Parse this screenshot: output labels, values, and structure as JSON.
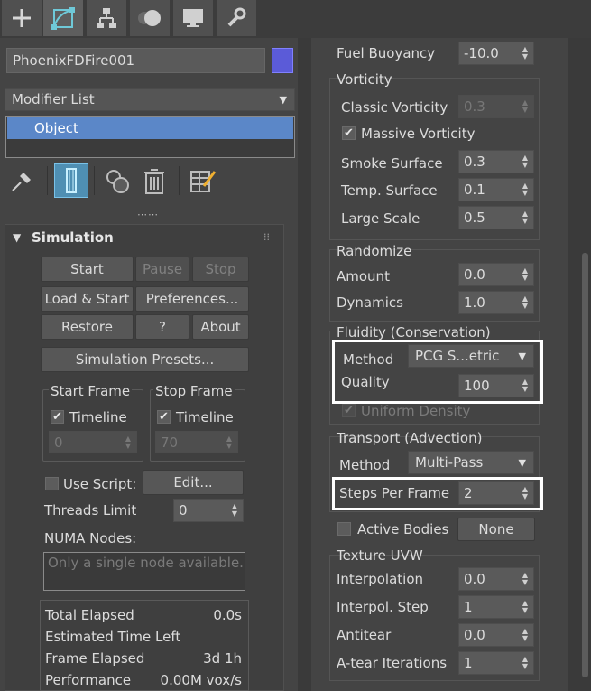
{
  "toolbar": {
    "tabs": [
      "create-icon",
      "modify-icon",
      "hierarchy-icon",
      "motion-icon",
      "display-icon",
      "utilities-icon"
    ]
  },
  "left": {
    "object_name": "PhoenixFDFire001",
    "object_color": "#5b5bd8",
    "modifier_list_label": "Modifier List",
    "stack_item": "Object",
    "rollout_title": "Simulation",
    "buttons": {
      "start": "Start",
      "pause": "Pause",
      "stop": "Stop",
      "load_start": "Load & Start",
      "preferences": "Preferences...",
      "restore": "Restore",
      "help": "?",
      "about": "About",
      "presets": "Simulation Presets...",
      "edit": "Edit..."
    },
    "start_frame": {
      "label": "Start Frame",
      "timeline_label": "Timeline",
      "value": "0"
    },
    "stop_frame": {
      "label": "Stop Frame",
      "timeline_label": "Timeline",
      "value": "70"
    },
    "use_script_label": "Use Script:",
    "threads_limit_label": "Threads Limit",
    "threads_limit_value": "0",
    "numa_label": "NUMA Nodes:",
    "numa_placeholder": "Only a single node available.",
    "stats": [
      {
        "label": "Total Elapsed",
        "value": "0.0s"
      },
      {
        "label": "Estimated Time Left",
        "value": ""
      },
      {
        "label": "Frame Elapsed",
        "value": "3d 1h"
      },
      {
        "label": "Performance",
        "value": "0.00M vox/s"
      }
    ]
  },
  "right": {
    "fuel_buoyancy": {
      "label": "Fuel Buoyancy",
      "value": "-10.0"
    },
    "vorticity": {
      "title": "Vorticity",
      "classic": {
        "label": "Classic Vorticity",
        "value": "0.3"
      },
      "massive_label": "Massive Vorticity",
      "smoke_surface": {
        "label": "Smoke Surface",
        "value": "0.3"
      },
      "temp_surface": {
        "label": "Temp. Surface",
        "value": "0.1"
      },
      "large_scale": {
        "label": "Large Scale",
        "value": "0.5"
      }
    },
    "randomize": {
      "title": "Randomize",
      "amount": {
        "label": "Amount",
        "value": "0.0"
      },
      "dynamics": {
        "label": "Dynamics",
        "value": "1.0"
      }
    },
    "fluidity": {
      "title": "Fluidity (Conservation)",
      "method": {
        "label": "Method",
        "value": "PCG S...etric"
      },
      "quality": {
        "label": "Quality",
        "value": "100"
      },
      "uniform_density_label": "Uniform Density"
    },
    "transport": {
      "title": "Transport (Advection)",
      "method": {
        "label": "Method",
        "value": "Multi-Pass"
      },
      "steps": {
        "label": "Steps Per Frame",
        "value": "2"
      }
    },
    "active_bodies": {
      "label": "Active Bodies",
      "button": "None"
    },
    "texture_uvw": {
      "title": "Texture UVW",
      "interpolation": {
        "label": "Interpolation",
        "value": "0.0"
      },
      "interpol_step": {
        "label": "Interpol. Step",
        "value": "1"
      },
      "antitear": {
        "label": "Antitear",
        "value": "0.0"
      },
      "atear_iterations": {
        "label": "A-tear Iterations",
        "value": "1"
      }
    }
  }
}
